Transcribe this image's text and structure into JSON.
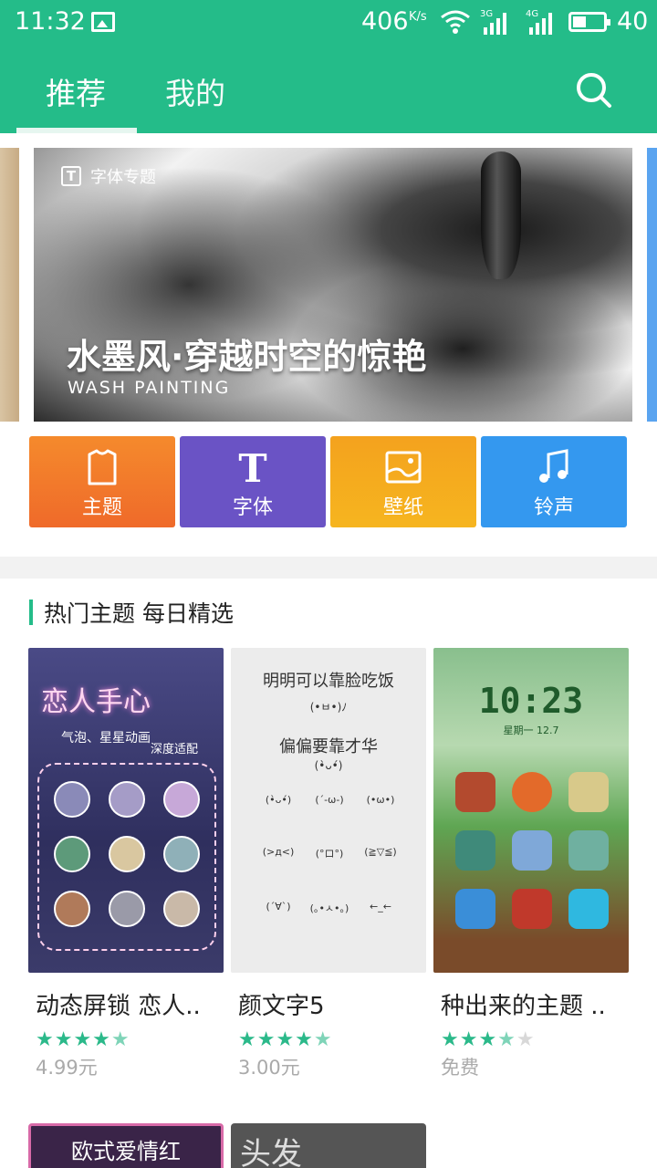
{
  "status_bar": {
    "time": "11:32",
    "net_speed": "406",
    "net_unit": "K/s",
    "sig1": "3G",
    "sig2": "4G",
    "battery": "40",
    "battery_level_pct": 40
  },
  "tabs": [
    {
      "label": "推荐",
      "active": true
    },
    {
      "label": "我的",
      "active": false
    }
  ],
  "banner": {
    "tag": "字体专题",
    "title": "水墨风·穿越时空的惊艳",
    "subtitle": "WASH PAINTING"
  },
  "categories": [
    {
      "label": "主题",
      "color": "#f0772a",
      "icon": "tshirt-icon"
    },
    {
      "label": "字体",
      "color": "#6a53c5",
      "icon": "font-icon"
    },
    {
      "label": "壁纸",
      "color": "#f5a61f",
      "icon": "wallpaper-icon"
    },
    {
      "label": "铃声",
      "color": "#3498ef",
      "icon": "music-icon"
    }
  ],
  "section": {
    "title": "热门主题 每日精选"
  },
  "themes": [
    {
      "name": "动态屏锁 恋人..",
      "rating": 4.5,
      "price": "4.99元",
      "preview_text": "恋人手心",
      "preview_sub1": "气泡、星星动画",
      "preview_sub2": "深度适配"
    },
    {
      "name": "颜文字5",
      "rating": 4.5,
      "price": "3.00元",
      "preview_text": "明明可以靠脸吃饭",
      "preview_sub1": "偏偏要靠才华"
    },
    {
      "name": "种出来的主题 ..",
      "rating": 3.5,
      "price": "免费",
      "preview_time": "10:23",
      "preview_date": "星期一 12.7"
    }
  ],
  "next_row": [
    {
      "preview_text": "欧式爱情红"
    },
    {
      "preview_text": "头发"
    }
  ]
}
